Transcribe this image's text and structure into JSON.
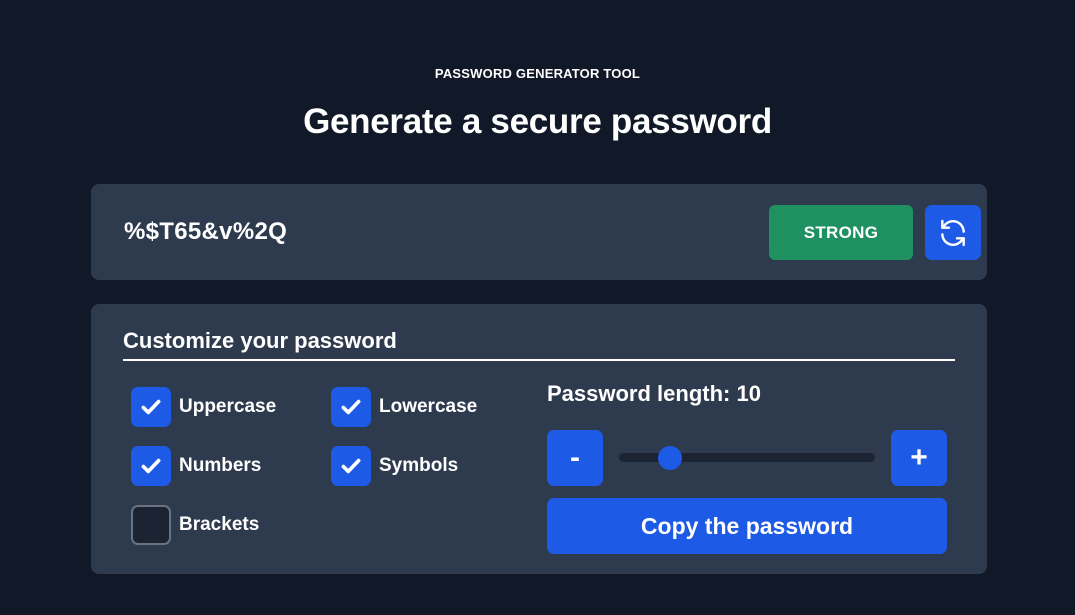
{
  "header": {
    "eyebrow": "PASSWORD GENERATOR TOOL",
    "title": "Generate a secure password"
  },
  "password": {
    "value": "%$T65&v%2Q",
    "strength": "STRONG",
    "strength_color": "#1f9160"
  },
  "options": {
    "title": "Customize your password",
    "checkboxes": [
      {
        "label": "Uppercase",
        "checked": true
      },
      {
        "label": "Lowercase",
        "checked": true
      },
      {
        "label": "Numbers",
        "checked": true
      },
      {
        "label": "Symbols",
        "checked": true
      },
      {
        "label": "Brackets",
        "checked": false
      }
    ],
    "length_label": "Password length: 10",
    "length": {
      "value": 10,
      "min": 6,
      "max": 30
    },
    "decrement_label": "-",
    "increment_label": "+",
    "copy_label": "Copy the password"
  },
  "icons": {
    "refresh": "refresh-icon",
    "check": "check-icon"
  },
  "colors": {
    "background": "#111827",
    "card": "#2e3a4d",
    "accent": "#1d5be6",
    "success": "#1f9160"
  }
}
